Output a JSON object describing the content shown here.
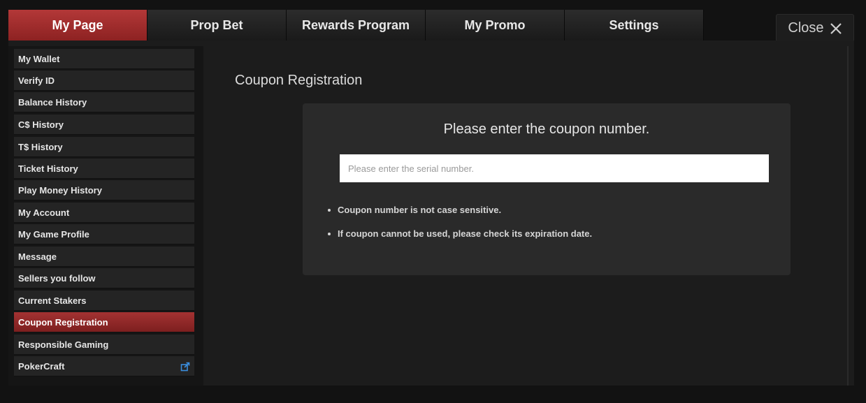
{
  "tabs": [
    {
      "label": "My Page",
      "active": true
    },
    {
      "label": "Prop Bet",
      "active": false
    },
    {
      "label": "Rewards Program",
      "active": false
    },
    {
      "label": "My Promo",
      "active": false
    },
    {
      "label": "Settings",
      "active": false
    }
  ],
  "close_label": "Close",
  "sidebar": {
    "items": [
      {
        "label": "My Wallet"
      },
      {
        "label": "Verify ID"
      },
      {
        "label": "Balance History"
      },
      {
        "label": "C$ History"
      },
      {
        "label": "T$ History"
      },
      {
        "label": "Ticket History"
      },
      {
        "label": "Play Money History"
      },
      {
        "label": "My Account"
      },
      {
        "label": "My Game Profile"
      },
      {
        "label": "Message"
      },
      {
        "label": "Sellers you follow"
      },
      {
        "label": "Current Stakers"
      },
      {
        "label": "Coupon Registration",
        "active": true
      },
      {
        "label": "Responsible Gaming"
      },
      {
        "label": "PokerCraft",
        "icon": "external-link-icon"
      }
    ]
  },
  "main": {
    "title": "Coupon Registration",
    "heading": "Please enter the coupon number.",
    "input": {
      "value": "",
      "placeholder": "Please enter the serial number."
    },
    "notes": [
      "Coupon number is not case sensitive.",
      "If coupon cannot be used, please check its expiration date."
    ]
  },
  "colors": {
    "accent": "#a33232",
    "background": "#121212",
    "panel": "#2a2a2a",
    "link_icon": "#3b8ede"
  }
}
